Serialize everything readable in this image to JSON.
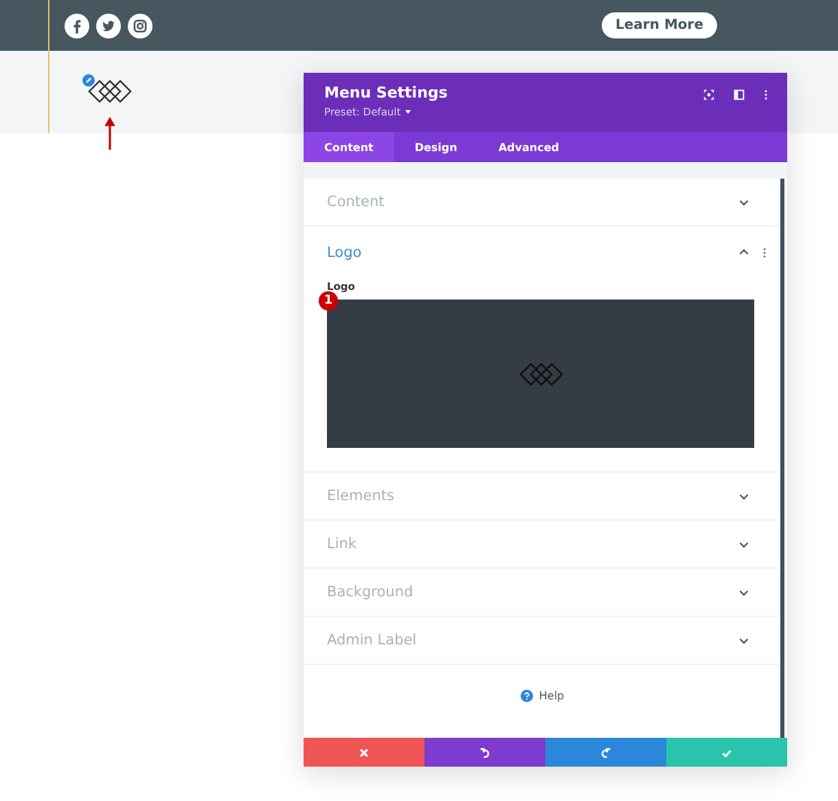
{
  "header": {
    "button": "Learn More"
  },
  "modal": {
    "title": "Menu Settings",
    "preset": "Preset: Default",
    "tabs": [
      {
        "label": "Content",
        "selected": true
      },
      {
        "label": "Design",
        "selected": false
      },
      {
        "label": "Advanced",
        "selected": false
      }
    ],
    "sections": [
      {
        "title": "Content",
        "expanded": false
      },
      {
        "title": "Logo",
        "expanded": true,
        "field_label": "Logo",
        "badge": "1"
      },
      {
        "title": "Elements",
        "expanded": false
      },
      {
        "title": "Link",
        "expanded": false
      },
      {
        "title": "Background",
        "expanded": false
      },
      {
        "title": "Admin Label",
        "expanded": false
      }
    ],
    "help": "Help"
  }
}
